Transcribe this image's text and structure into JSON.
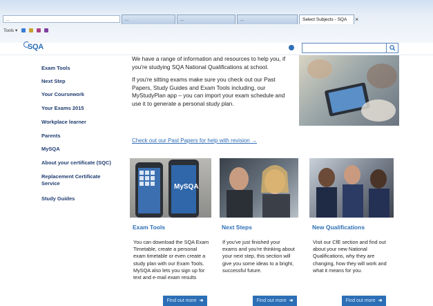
{
  "browser": {
    "address_text": "...",
    "tabs": [
      {
        "label": "..."
      },
      {
        "label": "..."
      },
      {
        "label": "..."
      },
      {
        "label": "Select Subjects - SQA"
      }
    ],
    "close_icon": "×",
    "menu": [
      "Tools ▾"
    ]
  },
  "header": {
    "logo_text": "SQA",
    "search": {
      "placeholder": "",
      "button_icon": "search-icon"
    }
  },
  "sidebar": {
    "items": [
      {
        "label": "Exam Tools"
      },
      {
        "label": "Next Step"
      },
      {
        "label": "Your Coursework"
      },
      {
        "label": "Your Exams 2015"
      },
      {
        "label": "Workplace learner"
      },
      {
        "label": "Parents"
      },
      {
        "label": "MySQA"
      },
      {
        "label": "About your certificate (SQC)"
      },
      {
        "label": "Replacement Certificate Service"
      },
      {
        "label": "Study Guides"
      }
    ]
  },
  "main": {
    "intro": [
      "We have a range of information and resources to help you, if you're studying SQA National Qualifications at school.",
      "If you're sitting exams make sure you check out our Past Papers, Study Guides and Exam Tools including, our MyStudyPlan app – you can import your exam schedule and use it to generate a personal study plan."
    ],
    "link": "Check out our Past Papers for help with revision →",
    "columns": [
      {
        "title": "Exam Tools",
        "body": "You can download the SQA Exam Timetable, create a personal exam timetable or even create a study plan with our Exam Tools. MySQA also lets you sign up for text and e-mail exam results",
        "button": "Find out more",
        "image_text": "MySQA"
      },
      {
        "title": "Next Steps",
        "body": "If you've just finished your exams and you're thinking about your next step, this section will give you some ideas to a bright, successful future.",
        "button": "Find out more"
      },
      {
        "title": "New Qualifications",
        "body": "Visit our CfE section and find out about your new National Qualifications, why they are changing, how they will work and what it means for you.",
        "button": "Find out more"
      }
    ]
  },
  "colors": {
    "accent": "#2c6fb6",
    "nav": "#1f3c70"
  }
}
